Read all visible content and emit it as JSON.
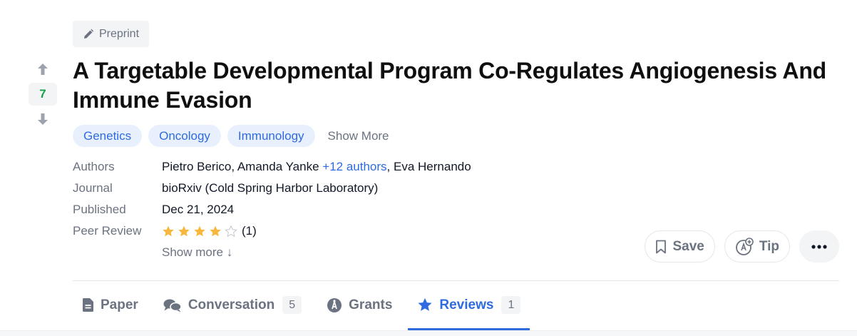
{
  "vote": {
    "count": "7"
  },
  "badge": {
    "label": "Preprint"
  },
  "title": "A Targetable Developmental Program Co-Regulates Angiogenesis And Immune Evasion",
  "tags": [
    "Genetics",
    "Oncology",
    "Immunology"
  ],
  "show_more_tags": "Show More",
  "meta": {
    "authors_label": "Authors",
    "author_1": "Pietro Berico,",
    "author_2": "Amanda Yanke",
    "more_authors": "+12 authors",
    "author_sep": ",",
    "author_last": "Eva Hernando",
    "journal_label": "Journal",
    "journal": "bioRxiv (Cold Spring Harbor Laboratory)",
    "published_label": "Published",
    "published": "Dec 21, 2024",
    "peer_review_label": "Peer Review",
    "rating": 4,
    "rating_max": 5,
    "review_count": "(1)",
    "show_more": "Show more ↓"
  },
  "actions": {
    "save": "Save",
    "tip": "Tip"
  },
  "tabs": [
    {
      "label": "Paper",
      "count": "",
      "icon": "document-icon"
    },
    {
      "label": "Conversation",
      "count": "5",
      "icon": "comments-icon"
    },
    {
      "label": "Grants",
      "count": "",
      "icon": "grant-icon"
    },
    {
      "label": "Reviews",
      "count": "1",
      "icon": "star-icon"
    }
  ],
  "colors": {
    "accent": "#2f6be0",
    "vote": "#16a34a",
    "star": "#f6b73c"
  }
}
